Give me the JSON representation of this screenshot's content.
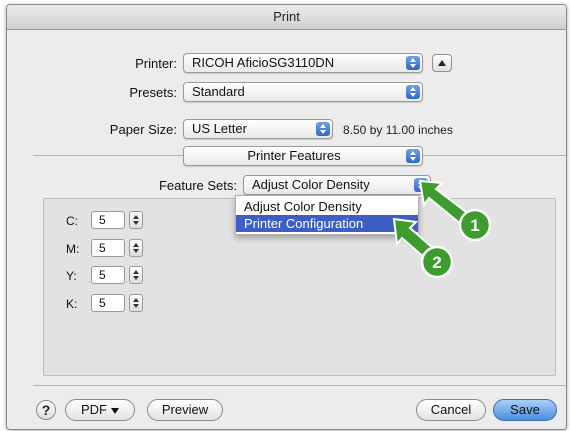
{
  "window": {
    "title": "Print"
  },
  "printer": {
    "label": "Printer:",
    "value": "RICOH AficioSG3110DN"
  },
  "presets": {
    "label": "Presets:",
    "value": "Standard"
  },
  "paper_size": {
    "label": "Paper Size:",
    "value": "US Letter",
    "dimensions": "8.50 by 11.00 inches"
  },
  "section": {
    "value": "Printer Features"
  },
  "feature_sets": {
    "label": "Feature Sets:",
    "value": "Adjust Color Density",
    "options": [
      "Adjust Color Density",
      "Printer Configuration"
    ],
    "highlighted": "Printer Configuration"
  },
  "color_density": [
    {
      "label": "C:",
      "value": "5"
    },
    {
      "label": "M:",
      "value": "5"
    },
    {
      "label": "Y:",
      "value": "5"
    },
    {
      "label": "K:",
      "value": "5"
    }
  ],
  "footer": {
    "help": "?",
    "pdf": "PDF",
    "preview": "Preview",
    "cancel": "Cancel",
    "save": "Save"
  },
  "callouts": [
    "1",
    "2"
  ],
  "colors": {
    "accent": "#3d5ec4",
    "callout": "#3e9b2e",
    "default_button": "#4a8de0"
  }
}
